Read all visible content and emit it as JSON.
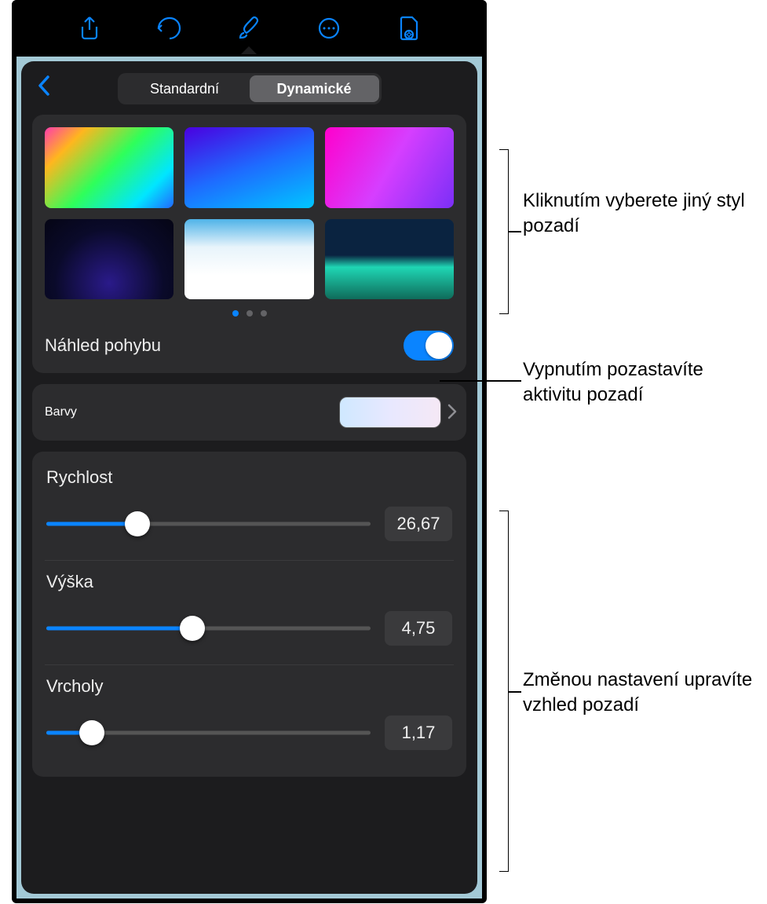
{
  "toolbar": {
    "share": "share-icon",
    "undo": "undo-icon",
    "brush": "brush-icon",
    "more": "more-icon",
    "doc": "document-icon"
  },
  "tabs": {
    "standard": "Standardní",
    "dynamic": "Dynamické"
  },
  "motion_preview": {
    "label": "Náhled pohybu",
    "on": true
  },
  "colors": {
    "label": "Barvy"
  },
  "sliders": {
    "speed": {
      "label": "Rychlost",
      "value": "26,67",
      "pct": 28
    },
    "height": {
      "label": "Výška",
      "value": "4,75",
      "pct": 45
    },
    "peaks": {
      "label": "Vrcholy",
      "value": "1,17",
      "pct": 14
    }
  },
  "callouts": {
    "c1": "Kliknutím vyberete jiný styl pozadí",
    "c2": "Vypnutím pozastavíte aktivitu pozadí",
    "c3": "Změnou nastavení upravíte vzhled pozadí"
  }
}
